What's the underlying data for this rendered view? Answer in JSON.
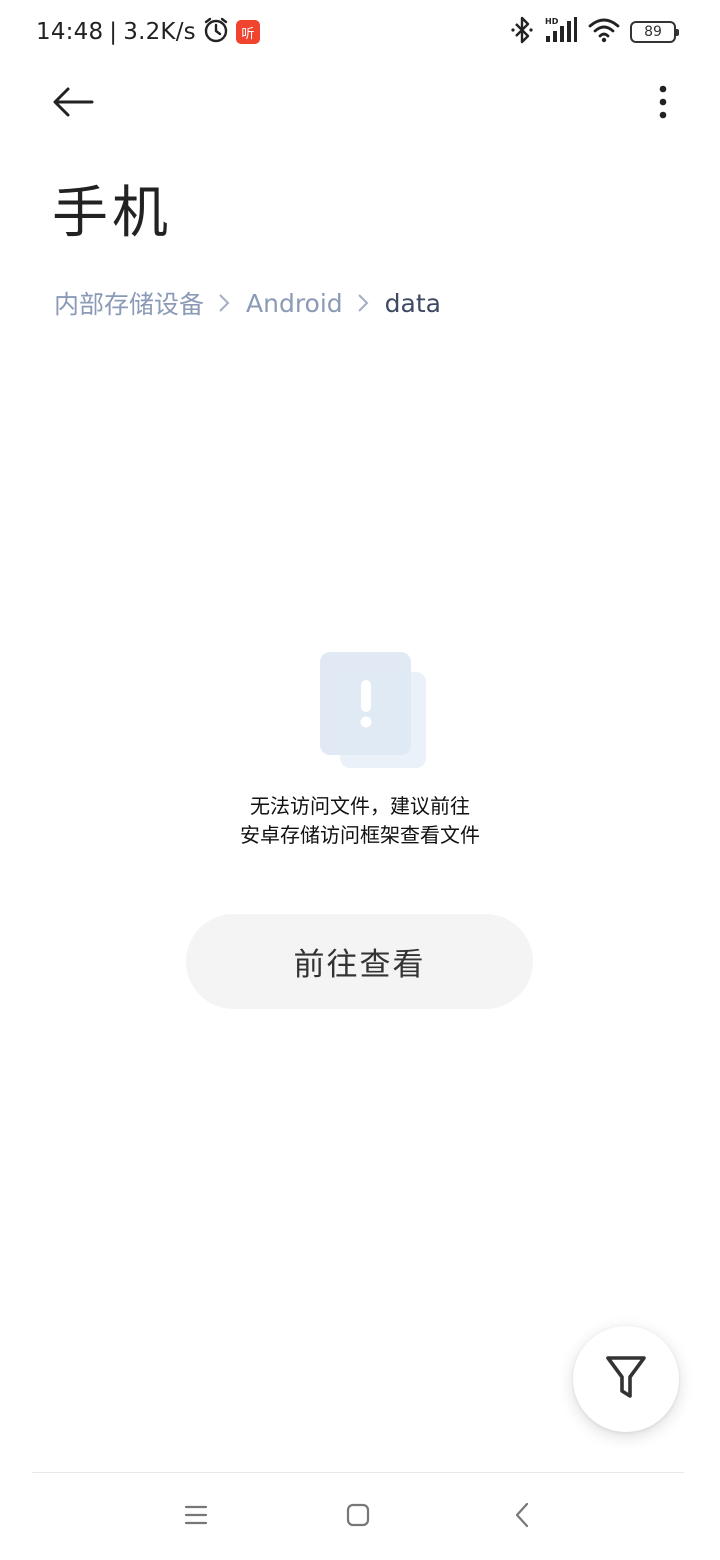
{
  "status_bar": {
    "time": "14:48",
    "separator": "|",
    "net_speed": "3.2K/s",
    "app_badge_text": "听",
    "battery_level": "89",
    "icons": [
      "alarm-icon",
      "app-badge-icon",
      "bluetooth-icon",
      "hd-signal-icon",
      "wifi-icon",
      "battery-icon"
    ]
  },
  "header": {
    "back_icon": "back-arrow-icon",
    "more_icon": "more-vertical-icon",
    "title": "手机"
  },
  "breadcrumb": {
    "items": [
      "内部存储设备",
      "Android",
      "data"
    ]
  },
  "empty_state": {
    "icon": "warning-icon",
    "line1": "无法访问文件，建议前往",
    "line2": "安卓存储访问框架查看文件",
    "button_label": "前往查看"
  },
  "fab": {
    "icon": "filter-icon"
  },
  "nav_bar": {
    "icons": [
      "menu-icon",
      "home-icon",
      "back-icon"
    ]
  },
  "colors": {
    "breadcrumb_inactive": "#8b9ab6",
    "breadcrumb_active": "#3e4a63",
    "button_bg": "#f4f4f4",
    "badge": "#f0442e"
  }
}
